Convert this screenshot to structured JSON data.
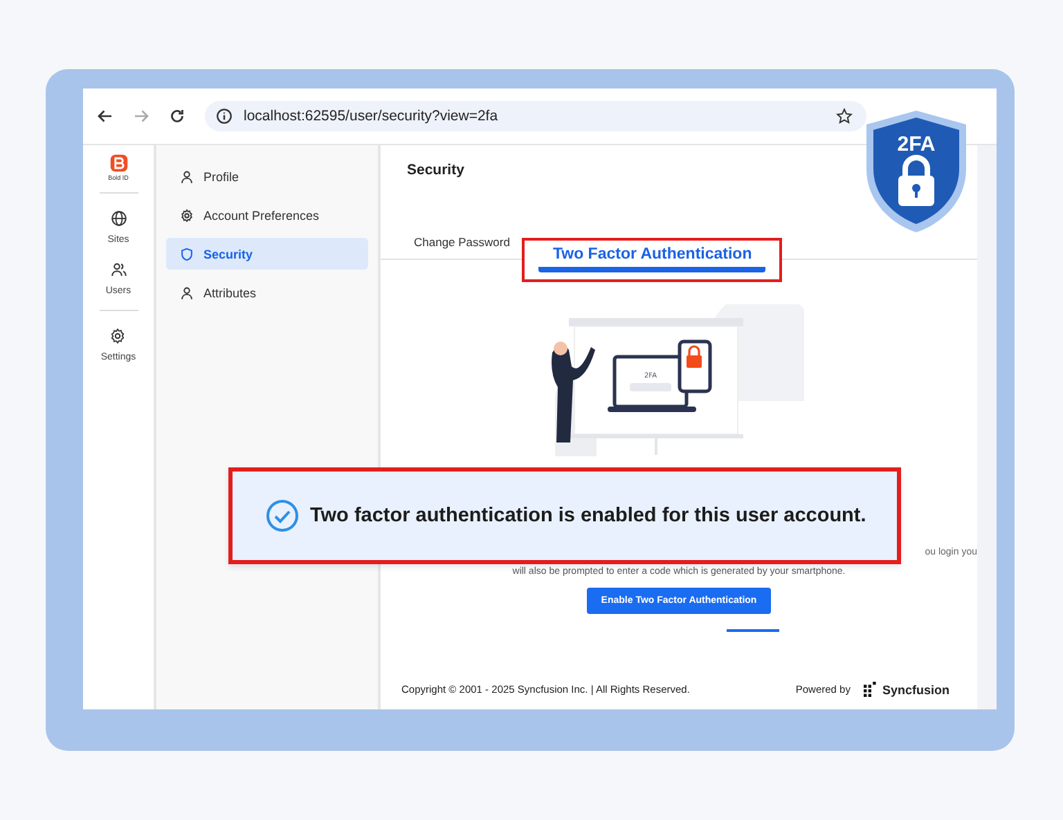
{
  "browser": {
    "url": "localhost:62595/user/security?view=2fa"
  },
  "badge": {
    "label": "2FA"
  },
  "rail": {
    "logo_label": "Bold ID",
    "items": [
      {
        "label": "Sites",
        "kind": "globe"
      },
      {
        "label": "Users",
        "kind": "users"
      },
      {
        "label": "Settings",
        "kind": "gear"
      }
    ]
  },
  "menu": [
    {
      "label": "Profile",
      "kind": "person",
      "selected": false
    },
    {
      "label": "Account Preferences",
      "kind": "gear",
      "selected": false
    },
    {
      "label": "Security",
      "kind": "shield",
      "selected": true
    },
    {
      "label": "Attributes",
      "kind": "person",
      "selected": false
    }
  ],
  "page": {
    "title": "Security",
    "tabs": [
      {
        "label": "Change Password",
        "selected": false,
        "highlighted": false
      },
      {
        "label": "Two Factor Authentication",
        "selected": true,
        "highlighted": true
      }
    ],
    "illustration": {
      "screen_label": "2FA"
    },
    "description": [
      "ou login you",
      "will also be prompted to enter a code which is generated by your smartphone."
    ],
    "button": "Enable Two Factor Authentication"
  },
  "footer": {
    "copyright": "Copyright © 2001 - 2025 Syncfusion Inc. | All Rights Reserved.",
    "powered_by": "Powered by",
    "brand": "Syncfusion"
  },
  "callout": {
    "message": "Two factor authentication is enabled for this user account.",
    "highlighted": true
  }
}
